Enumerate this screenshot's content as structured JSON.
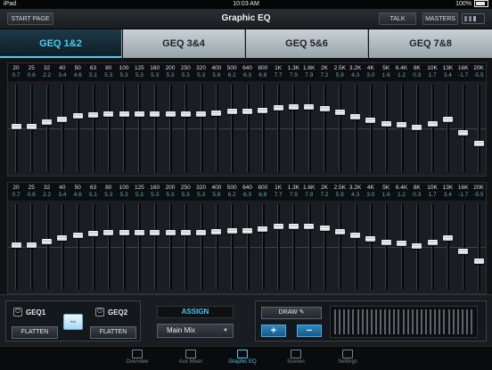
{
  "statusbar": {
    "device": "iPad",
    "time": "10:03 AM",
    "battery": "100%"
  },
  "topbar": {
    "start_page": "START PAGE",
    "title": "Graphic EQ",
    "talk": "TALK",
    "masters": "MASTERS"
  },
  "tabs": [
    {
      "label": "GEQ 1&2",
      "active": true
    },
    {
      "label": "GEQ 3&4",
      "active": false
    },
    {
      "label": "GEQ 5&6",
      "active": false
    },
    {
      "label": "GEQ 7&8",
      "active": false
    }
  ],
  "eq_top": {
    "freqs": [
      "20",
      "25",
      "32",
      "40",
      "50",
      "63",
      "80",
      "100",
      "125",
      "160",
      "200",
      "250",
      "320",
      "400",
      "500",
      "640",
      "800",
      "1K",
      "1.3K",
      "1.6K",
      "2K",
      "2.5K",
      "3.2K",
      "4K",
      "5K",
      "6.4K",
      "8K",
      "10K",
      "13K",
      "16K",
      "20K"
    ],
    "gains": [
      "0.7",
      "0.8",
      "2.2",
      "3.4",
      "4.6",
      "5.1",
      "5.3",
      "5.3",
      "5.3",
      "5.3",
      "5.3",
      "5.3",
      "5.3",
      "5.8",
      "6.2",
      "6.3",
      "6.8",
      "7.7",
      "7.9",
      "7.9",
      "7.2",
      "5.9",
      "4.3",
      "3.0",
      "1.6",
      "1.2",
      "0.3",
      "1.7",
      "3.4",
      "-1.7",
      "-5.5"
    ]
  },
  "eq_bottom": {
    "freqs": [
      "20",
      "25",
      "32",
      "40",
      "50",
      "63",
      "80",
      "100",
      "125",
      "160",
      "200",
      "250",
      "320",
      "400",
      "500",
      "640",
      "800",
      "1K",
      "1.3K",
      "1.6K",
      "2K",
      "2.5K",
      "3.2K",
      "4K",
      "5K",
      "6.4K",
      "8K",
      "10K",
      "13K",
      "16K",
      "20K"
    ],
    "gains": [
      "0.7",
      "0.8",
      "2.2",
      "3.4",
      "4.6",
      "5.1",
      "5.3",
      "5.3",
      "5.3",
      "5.3",
      "5.3",
      "5.3",
      "5.3",
      "5.8",
      "6.2",
      "6.3",
      "6.8",
      "7.7",
      "7.9",
      "7.9",
      "7.2",
      "5.9",
      "4.3",
      "3.0",
      "1.6",
      "1.2",
      "0.3",
      "1.7",
      "3.4",
      "-1.7",
      "-5.5"
    ]
  },
  "bottom": {
    "geq1": "GEQ1",
    "geq2": "GEQ2",
    "flatten": "FLATTEN",
    "assign": "ASSIGN",
    "main_mix": "Main Mix",
    "draw": "DRAW",
    "plus": "+",
    "minus": "−"
  },
  "nav": [
    {
      "label": "Overview",
      "icon": "overview-icon",
      "active": false
    },
    {
      "label": "Aux Mixer",
      "icon": "aux-mixer-icon",
      "active": false
    },
    {
      "label": "Graphic EQ",
      "icon": "graphic-eq-icon",
      "active": true
    },
    {
      "label": "Scenes",
      "icon": "scenes-icon",
      "active": false
    },
    {
      "label": "Settings",
      "icon": "settings-icon",
      "active": false
    }
  ],
  "colors": {
    "accent": "#3fd0f0",
    "gain_text": "#4fb0c0"
  }
}
